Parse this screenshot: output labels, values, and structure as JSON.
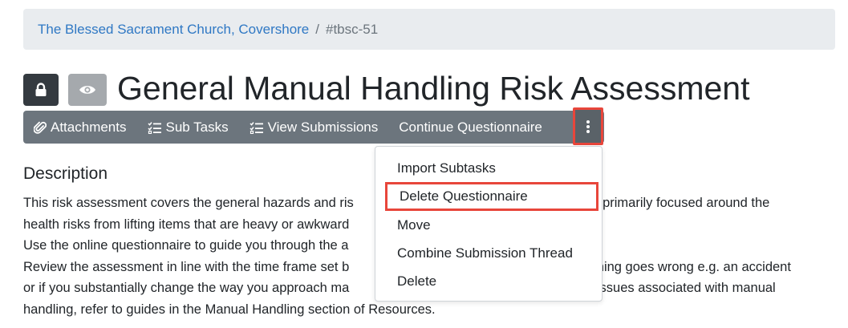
{
  "breadcrumb": {
    "link": "The Blessed Sacrament Church, Covershore",
    "separator": "/",
    "current": "#tbsc-51"
  },
  "header": {
    "lock_icon": "lock-icon",
    "eye_icon": "eye-icon",
    "title": "General Manual Handling Risk Assessment"
  },
  "toolbar": {
    "attachments": "Attachments",
    "sub_tasks": "Sub Tasks",
    "view_submissions": "View Submissions",
    "continue_questionnaire": "Continue Questionnaire",
    "more_icon": "vertical-ellipsis-icon"
  },
  "dropdown": {
    "items": [
      "Import Subtasks",
      "Delete Questionnaire",
      "Move",
      "Combine Submission Thread",
      "Delete"
    ]
  },
  "description": {
    "heading": "Description",
    "lines": [
      "This risk assessment covers the general hazards and ris",
      "sks primarily focused around the",
      "health risks from lifting items that are heavy or awkward",
      "Use the online questionnaire to guide you through the a",
      "Review the assessment in line with the time frame set b",
      "mething goes wrong e.g. an accident",
      "or if you substantially change the way you approach ma",
      "the issues associated with manual",
      "handling, refer to guides in the Manual Handling section of Resources."
    ]
  },
  "colors": {
    "accent_link": "#2f78c4",
    "toolbar_bg": "#6c757d",
    "highlight": "#e8463b"
  }
}
